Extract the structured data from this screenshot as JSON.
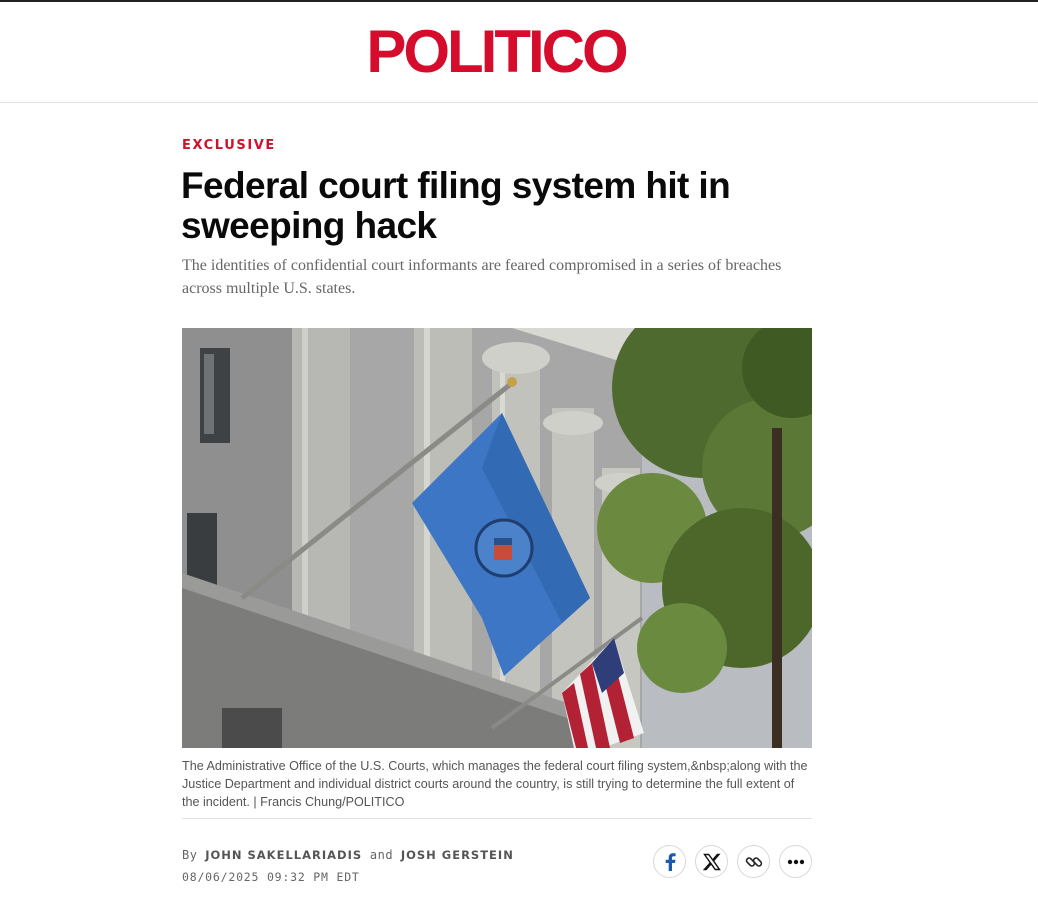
{
  "brand": {
    "logo_text": "POLITICO",
    "accent_color": "#d50c2c"
  },
  "article": {
    "kicker": "EXCLUSIVE",
    "headline": "Federal court filing system hit in sweeping hack",
    "dek": "The identities of confidential court informants are feared compromised in a series of breaches across multiple U.S. states.",
    "image": {
      "description_icon": "photo-justice-department-building-flags",
      "caption": "The Administrative Office of the U.S. Courts, which manages the federal court filing system,&nbsp;along with the Justice Department and individual district courts around the country, is still trying to determine the full extent of the incident. | Francis Chung/POLITICO"
    },
    "byline": {
      "prefix": "By",
      "author1": "JOHN SAKELLARIADIS",
      "joiner": "and",
      "author2": "JOSH GERSTEIN"
    },
    "timestamp": "08/06/2025 09:32 PM EDT"
  },
  "share": {
    "buttons": [
      {
        "icon": "facebook-icon"
      },
      {
        "icon": "x-icon"
      },
      {
        "icon": "link-icon"
      },
      {
        "icon": "more-icon"
      }
    ]
  }
}
